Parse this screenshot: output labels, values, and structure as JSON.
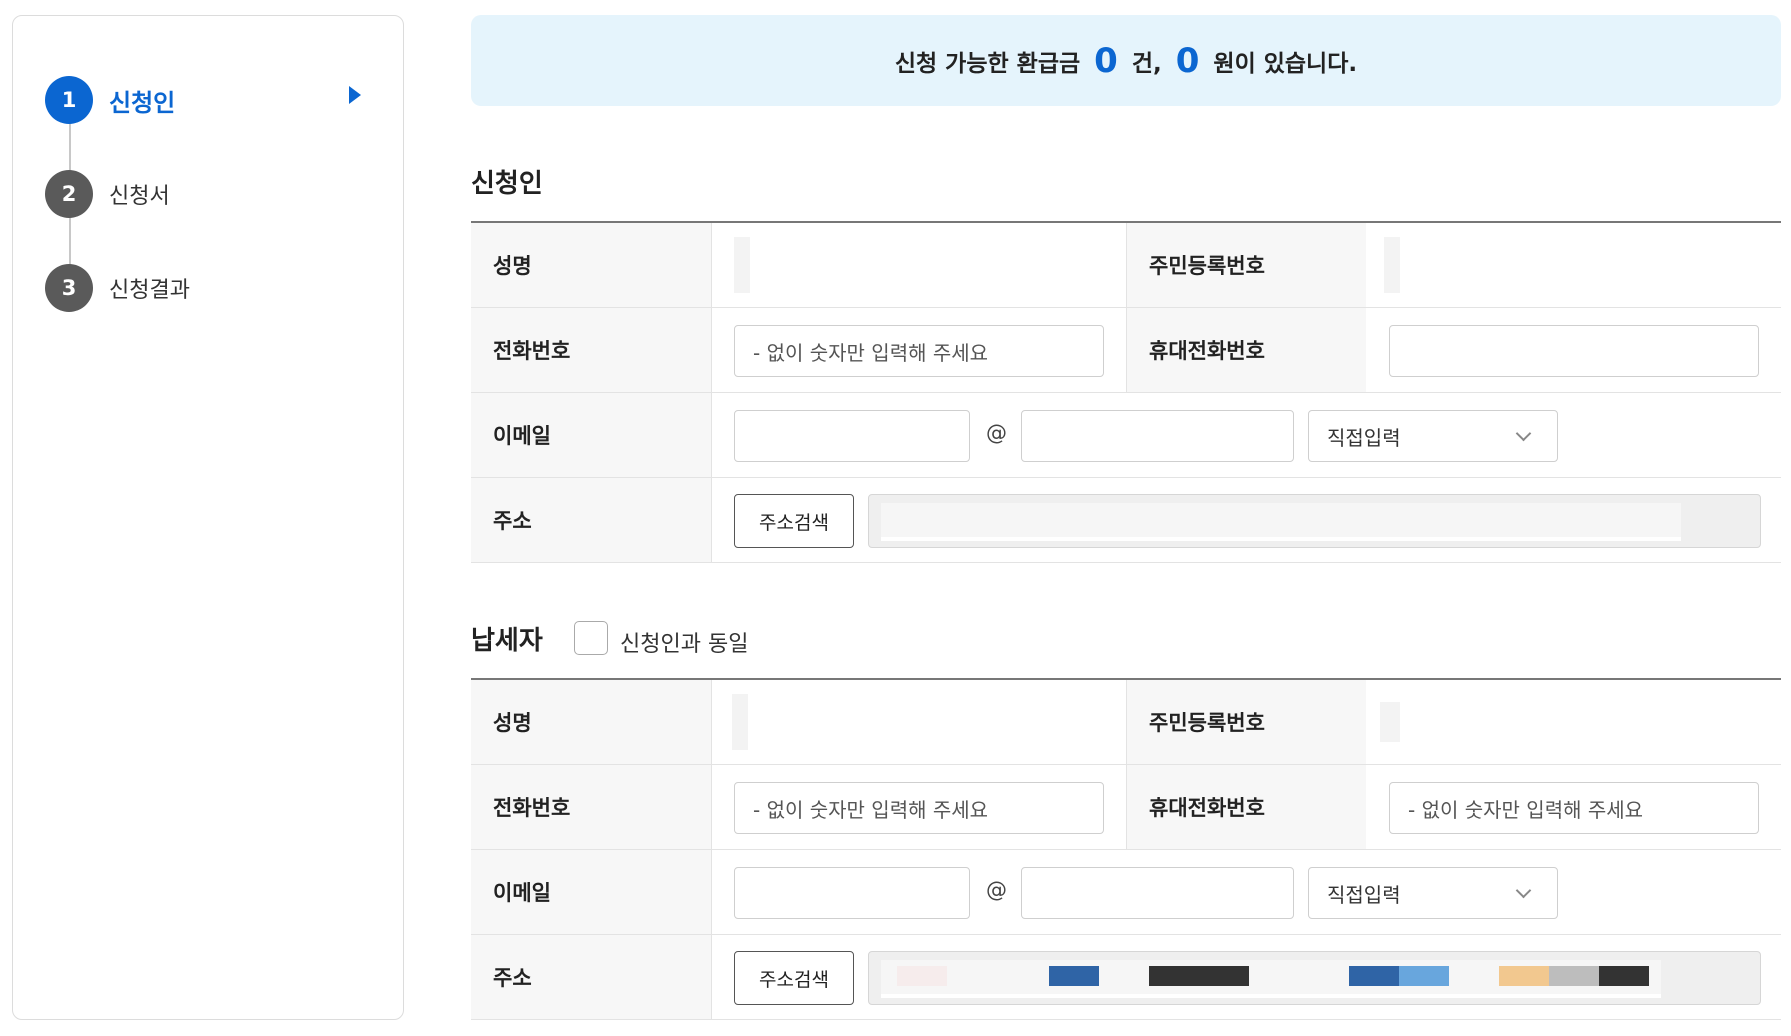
{
  "steps": [
    {
      "number": "1",
      "label": "신청인",
      "active": true
    },
    {
      "number": "2",
      "label": "신청서",
      "active": false
    },
    {
      "number": "3",
      "label": "신청결과",
      "active": false
    }
  ],
  "banner": {
    "prefix": "신청 가능한 환급금",
    "count": "0",
    "count_unit": "건,",
    "amount": "0",
    "suffix": "원이 있습니다."
  },
  "applicant": {
    "title": "신청인",
    "name_label": "성명",
    "rrn_label": "주민등록번호",
    "phone_label": "전화번호",
    "phone_placeholder": "- 없이 숫자만 입력해 주세요",
    "mobile_label": "휴대전화번호",
    "mobile_placeholder": "",
    "email_label": "이메일",
    "email_at": "@",
    "email_domain_select": "직접입력",
    "address_label": "주소",
    "address_button": "주소검색"
  },
  "taxpayer": {
    "title": "납세자",
    "same_as_label": "신청인과 동일",
    "name_label": "성명",
    "rrn_label": "주민등록번호",
    "phone_label": "전화번호",
    "phone_placeholder": "- 없이 숫자만 입력해 주세요",
    "mobile_label": "휴대전화번호",
    "mobile_placeholder": "- 없이 숫자만 입력해 주세요",
    "email_label": "이메일",
    "email_at": "@",
    "email_domain_select": "직접입력",
    "address_label": "주소",
    "address_button": "주소검색"
  },
  "colors": {
    "accent": "#0b66d1",
    "banner_bg": "#e5f4fc",
    "label_bg": "#f7f7f7",
    "step_inactive": "#5a5a5a"
  }
}
